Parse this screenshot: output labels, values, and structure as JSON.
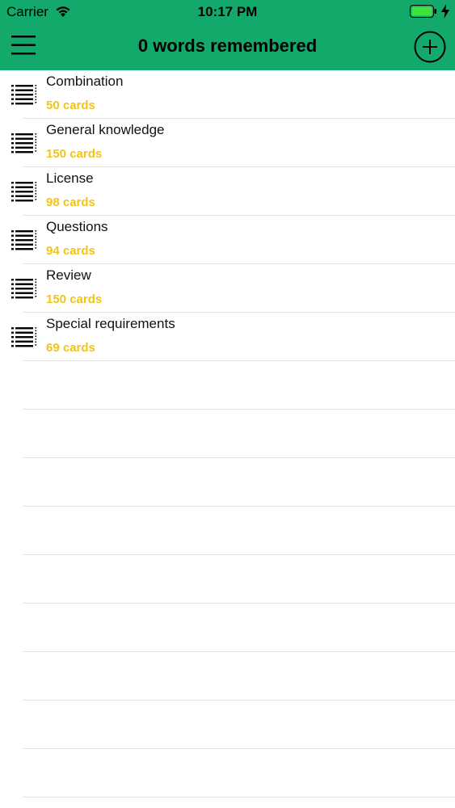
{
  "status_bar": {
    "carrier": "Carrier",
    "time": "10:17 PM",
    "wifi_icon": "wifi-icon",
    "battery_icon": "battery-icon",
    "charging_icon": "charging-bolt-icon"
  },
  "nav": {
    "title": "0 words remembered",
    "menu_icon": "hamburger-menu-icon",
    "add_icon": "plus-circle-icon",
    "background_color": "#13a96b"
  },
  "decks": [
    {
      "name": "Combination",
      "count": "50 cards"
    },
    {
      "name": "General knowledge",
      "count": "150 cards"
    },
    {
      "name": "License",
      "count": "98 cards"
    },
    {
      "name": "Questions",
      "count": "94 cards"
    },
    {
      "name": "Review",
      "count": "150 cards"
    },
    {
      "name": "Special requirements",
      "count": "69 cards"
    }
  ],
  "deck_icon": "list-icon",
  "count_color": "#f0c419"
}
